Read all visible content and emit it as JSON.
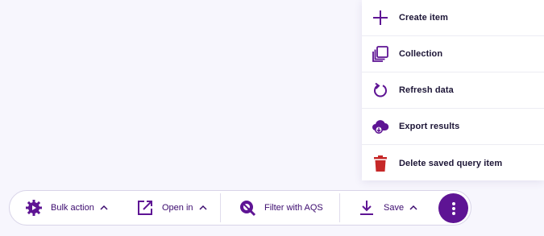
{
  "menu": {
    "items": [
      {
        "label": "Create item",
        "icon": "plus-icon"
      },
      {
        "label": "Collection",
        "icon": "collection-icon"
      },
      {
        "label": "Refresh data",
        "icon": "refresh-icon"
      },
      {
        "label": "Export results",
        "icon": "cloud-export-icon"
      },
      {
        "label": "Delete saved query item",
        "icon": "trash-icon"
      }
    ]
  },
  "toolbar": {
    "bulk_action_label": "Bulk action",
    "open_in_label": "Open in",
    "filter_label": "Filter with AQS",
    "save_label": "Save"
  },
  "colors": {
    "accent": "#5e1494",
    "icon": "#6a0dad",
    "danger": "#c62828",
    "text": "#1c1536"
  }
}
